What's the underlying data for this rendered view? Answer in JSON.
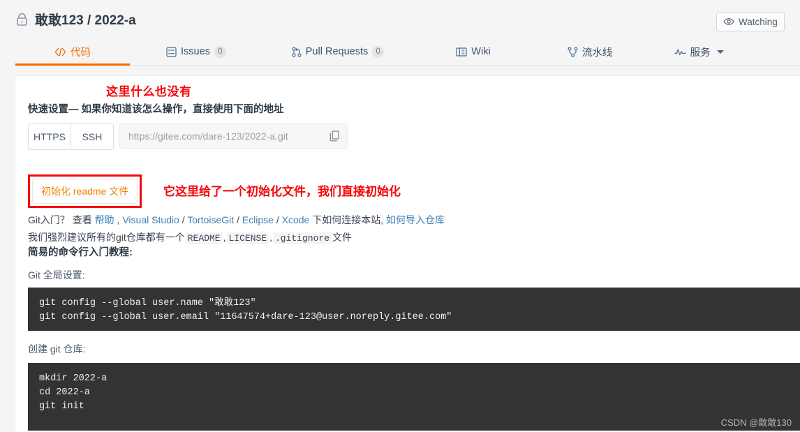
{
  "header": {
    "lock_icon": "lock-icon",
    "owner": "敢敢123",
    "separator": "/",
    "repo": "2022-a",
    "title_full": "敢敢123 / 2022-a",
    "watching_label": "Watching",
    "watching_icon": "eye-icon"
  },
  "tabs": [
    {
      "id": "code",
      "label": "代码",
      "icon": "code-brackets-icon",
      "count": null,
      "active": true,
      "caret": false
    },
    {
      "id": "issues",
      "label": "Issues",
      "icon": "issue-list-icon",
      "count": "0",
      "active": false,
      "caret": false
    },
    {
      "id": "pr",
      "label": "Pull Requests",
      "icon": "pull-request-icon",
      "count": "0",
      "active": false,
      "caret": false
    },
    {
      "id": "wiki",
      "label": "Wiki",
      "icon": "book-icon",
      "count": null,
      "active": false,
      "caret": false
    },
    {
      "id": "pipe",
      "label": "流水线",
      "icon": "pipeline-icon",
      "count": null,
      "active": false,
      "caret": false
    },
    {
      "id": "serv",
      "label": "服务",
      "icon": "activity-icon",
      "count": null,
      "active": false,
      "caret": true
    }
  ],
  "annotations": {
    "top_note": "这里什么也没有",
    "init_note": "它这里给了一个初始化文件，我们直接初始化",
    "color": "#f60707"
  },
  "quick_setup": {
    "heading": "快速设置— 如果你知道该怎么操作，直接使用下面的地址",
    "protocol_https": "HTTPS",
    "protocol_ssh": "SSH",
    "clone_url": "https://gitee.com/dare-123/2022-a.git",
    "copy_icon": "copy-icon"
  },
  "recommend": {
    "prefix": "我们强烈建议所有的git仓库都有一个 ",
    "readme": "README",
    "comma1": " , ",
    "license": "LICENSE",
    "comma2": " , ",
    "gitignore": ".gitignore",
    "suffix": " 文件"
  },
  "init_button": {
    "label": "初始化 readme 文件",
    "text_color": "#f08300",
    "annotation_border": "#f60707"
  },
  "git_intro": {
    "lead": "Git入门？ 查看 ",
    "help": "帮助",
    "sep1": " , ",
    "visual_studio": "Visual Studio",
    "slash1": " / ",
    "tortoisegit": "TortoiseGit",
    "slash2": " / ",
    "eclipse": "Eclipse",
    "slash3": " / ",
    "xcode": "Xcode",
    "mid": " 下如何连接本站, ",
    "import": "如何导入仓库",
    "link_color": "#3f7fb5"
  },
  "cli_tutorial": {
    "section_title": "简易的命令行入门教程:",
    "global_label": "Git 全局设置:",
    "global_code": "git config --global user.name \"敢敢123\"\ngit config --global user.email \"11647574+dare-123@user.noreply.gitee.com\"",
    "create_label": "创建 git 仓库:",
    "create_code": "mkdir 2022-a\ncd 2022-a\ngit init"
  },
  "watermark": "CSDN @敢敢130",
  "theme": {
    "accent_orange": "#f26a00",
    "page_bg": "#f5f5f5",
    "panel_bg": "#ffffff",
    "code_bg": "#333333",
    "link_blue": "#3f7fb5"
  }
}
